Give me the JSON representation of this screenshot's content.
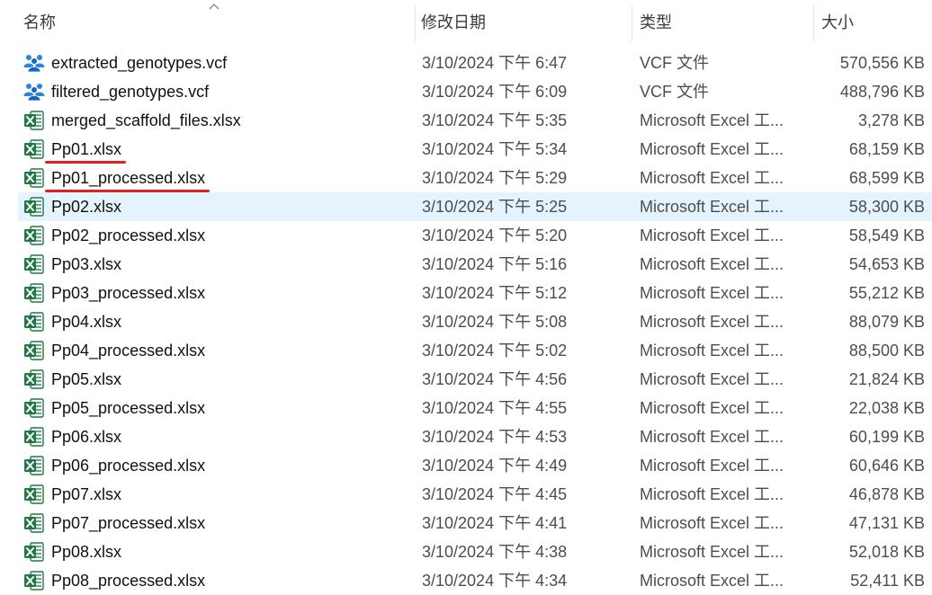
{
  "header": {
    "name": "名称",
    "date": "修改日期",
    "type": "类型",
    "size": "大小"
  },
  "selected_index": 5,
  "underlined_indices": [
    3,
    4
  ],
  "files": [
    {
      "name": "extracted_genotypes.vcf",
      "date": "3/10/2024 下午 6:47",
      "type": "VCF 文件",
      "size": "570,556 KB",
      "icon": "vcf-file-icon"
    },
    {
      "name": "filtered_genotypes.vcf",
      "date": "3/10/2024 下午 6:09",
      "type": "VCF 文件",
      "size": "488,796 KB",
      "icon": "vcf-file-icon"
    },
    {
      "name": "merged_scaffold_files.xlsx",
      "date": "3/10/2024 下午 5:35",
      "type": "Microsoft Excel 工...",
      "size": "3,278 KB",
      "icon": "excel-file-icon"
    },
    {
      "name": "Pp01.xlsx",
      "date": "3/10/2024 下午 5:34",
      "type": "Microsoft Excel 工...",
      "size": "68,159 KB",
      "icon": "excel-file-icon"
    },
    {
      "name": "Pp01_processed.xlsx",
      "date": "3/10/2024 下午 5:29",
      "type": "Microsoft Excel 工...",
      "size": "68,599 KB",
      "icon": "excel-file-icon"
    },
    {
      "name": "Pp02.xlsx",
      "date": "3/10/2024 下午 5:25",
      "type": "Microsoft Excel 工...",
      "size": "58,300 KB",
      "icon": "excel-file-icon"
    },
    {
      "name": "Pp02_processed.xlsx",
      "date": "3/10/2024 下午 5:20",
      "type": "Microsoft Excel 工...",
      "size": "58,549 KB",
      "icon": "excel-file-icon"
    },
    {
      "name": "Pp03.xlsx",
      "date": "3/10/2024 下午 5:16",
      "type": "Microsoft Excel 工...",
      "size": "54,653 KB",
      "icon": "excel-file-icon"
    },
    {
      "name": "Pp03_processed.xlsx",
      "date": "3/10/2024 下午 5:12",
      "type": "Microsoft Excel 工...",
      "size": "55,212 KB",
      "icon": "excel-file-icon"
    },
    {
      "name": "Pp04.xlsx",
      "date": "3/10/2024 下午 5:08",
      "type": "Microsoft Excel 工...",
      "size": "88,079 KB",
      "icon": "excel-file-icon"
    },
    {
      "name": "Pp04_processed.xlsx",
      "date": "3/10/2024 下午 5:02",
      "type": "Microsoft Excel 工...",
      "size": "88,500 KB",
      "icon": "excel-file-icon"
    },
    {
      "name": "Pp05.xlsx",
      "date": "3/10/2024 下午 4:56",
      "type": "Microsoft Excel 工...",
      "size": "21,824 KB",
      "icon": "excel-file-icon"
    },
    {
      "name": "Pp05_processed.xlsx",
      "date": "3/10/2024 下午 4:55",
      "type": "Microsoft Excel 工...",
      "size": "22,038 KB",
      "icon": "excel-file-icon"
    },
    {
      "name": "Pp06.xlsx",
      "date": "3/10/2024 下午 4:53",
      "type": "Microsoft Excel 工...",
      "size": "60,199 KB",
      "icon": "excel-file-icon"
    },
    {
      "name": "Pp06_processed.xlsx",
      "date": "3/10/2024 下午 4:49",
      "type": "Microsoft Excel 工...",
      "size": "60,646 KB",
      "icon": "excel-file-icon"
    },
    {
      "name": "Pp07.xlsx",
      "date": "3/10/2024 下午 4:45",
      "type": "Microsoft Excel 工...",
      "size": "46,878 KB",
      "icon": "excel-file-icon"
    },
    {
      "name": "Pp07_processed.xlsx",
      "date": "3/10/2024 下午 4:41",
      "type": "Microsoft Excel 工...",
      "size": "47,131 KB",
      "icon": "excel-file-icon"
    },
    {
      "name": "Pp08.xlsx",
      "date": "3/10/2024 下午 4:38",
      "type": "Microsoft Excel 工...",
      "size": "52,018 KB",
      "icon": "excel-file-icon"
    },
    {
      "name": "Pp08_processed.xlsx",
      "date": "3/10/2024 下午 4:34",
      "type": "Microsoft Excel 工...",
      "size": "52,411 KB",
      "icon": "excel-file-icon"
    }
  ],
  "colors": {
    "selection": "#e5f3ff",
    "underline": "#e0201b",
    "excel_green": "#1e7a45",
    "vcf_blue": "#1f78d1"
  }
}
